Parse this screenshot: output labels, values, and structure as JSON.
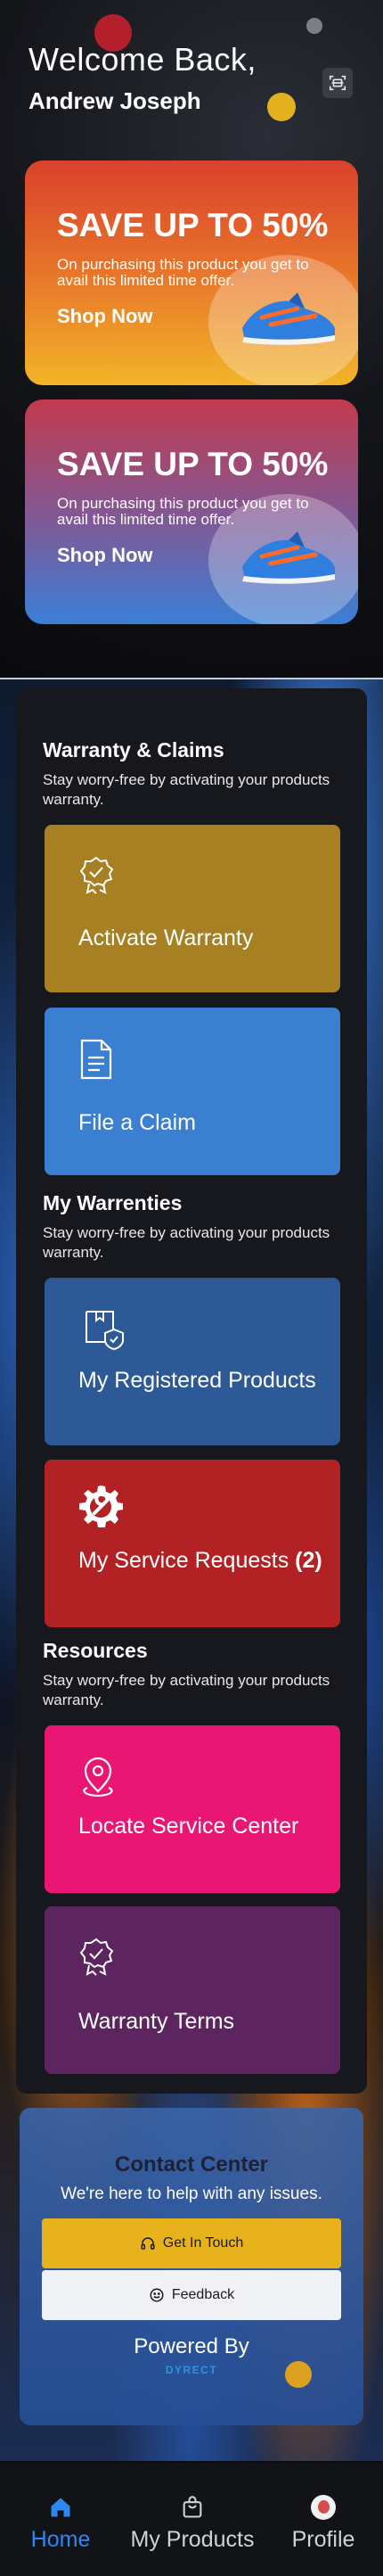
{
  "header": {
    "welcome": "Welcome Back,",
    "username": "Andrew Joseph",
    "scan_icon": "scan-icon"
  },
  "promos": [
    {
      "title": "SAVE UP TO 50%",
      "description": "On purchasing this product you get to avail this limited time offer.",
      "cta": "Shop Now",
      "image": "sneaker-image"
    },
    {
      "title": "SAVE UP TO 50%",
      "description": "On purchasing this product you get to avail this limited time offer.",
      "cta": "Shop Now",
      "image": "sneaker-image"
    }
  ],
  "warranty_claims": {
    "title": "Warranty & Claims",
    "description": "Stay worry-free by activating your products warranty.",
    "tiles": [
      {
        "label": "Activate Warranty",
        "icon": "badge-check-icon",
        "color": "#a68022"
      },
      {
        "label": "File a Claim",
        "icon": "document-icon",
        "color": "#3a7fd0"
      }
    ]
  },
  "my_warranties": {
    "title": "My Warrenties",
    "description": "Stay worry-free by activating your products warranty.",
    "tiles": [
      {
        "label": "My Registered Products",
        "icon": "box-shield-icon",
        "color": "#2d5a96"
      },
      {
        "label": "My Service Requests",
        "count": "(2)",
        "icon": "gear-wrench-icon",
        "color": "#b22225"
      }
    ]
  },
  "resources": {
    "title": "Resources",
    "description": "Stay worry-free by activating your products warranty.",
    "tiles": [
      {
        "label": "Locate Service Center",
        "icon": "map-pin-icon",
        "color": "#e91674"
      },
      {
        "label": "Warranty Terms",
        "icon": "badge-check-icon",
        "color": "#5c2560"
      }
    ]
  },
  "contact": {
    "title": "Contact Center",
    "subtitle": "We're here to help with any issues.",
    "get_in_touch": "Get In Touch",
    "feedback": "Feedback",
    "powered_by": "Powered By",
    "brand": "DYRECT"
  },
  "nav": {
    "home": "Home",
    "products": "My Products",
    "profile": "Profile",
    "active": "home",
    "active_color": "#2e86f0"
  }
}
